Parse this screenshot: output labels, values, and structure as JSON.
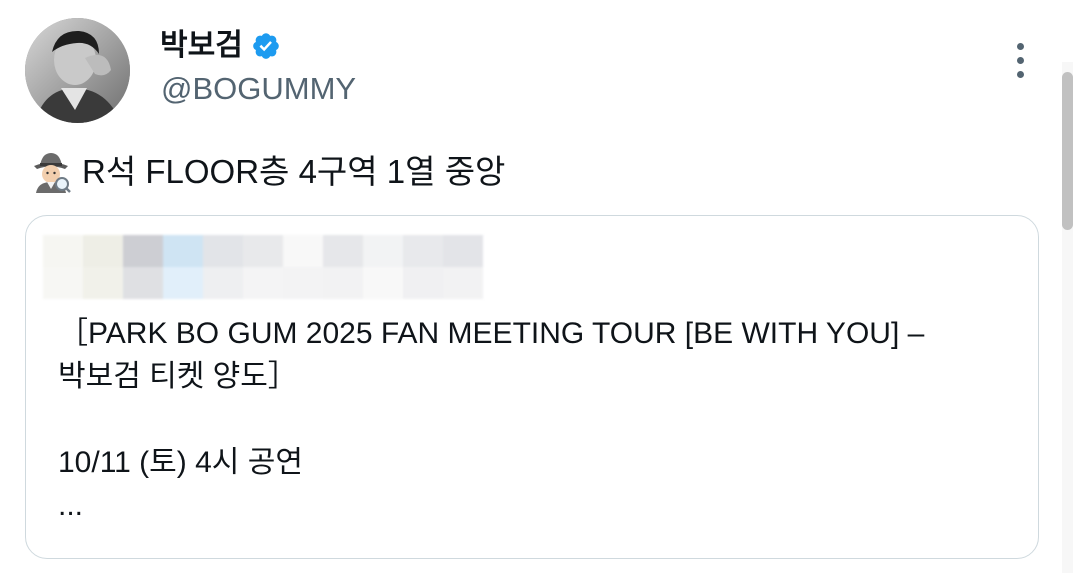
{
  "author": {
    "display_name": "박보검",
    "handle": "@BOGUMMY",
    "verified": true
  },
  "tweet": {
    "text": "R석 FLOOR층 4구역 1열 중앙",
    "emoji": "detective-icon"
  },
  "quote": {
    "line1": "［PARK BO GUM 2025 FAN MEETING TOUR [BE WITH YOU] –",
    "line2": "박보검 티켓 양도］",
    "line3": "10/11 (토) 4시 공연",
    "line4": "..."
  },
  "colors": {
    "verified": "#1d9bf0",
    "secondary_text": "#536471",
    "border": "#cfd9de",
    "text": "#0f1419"
  }
}
